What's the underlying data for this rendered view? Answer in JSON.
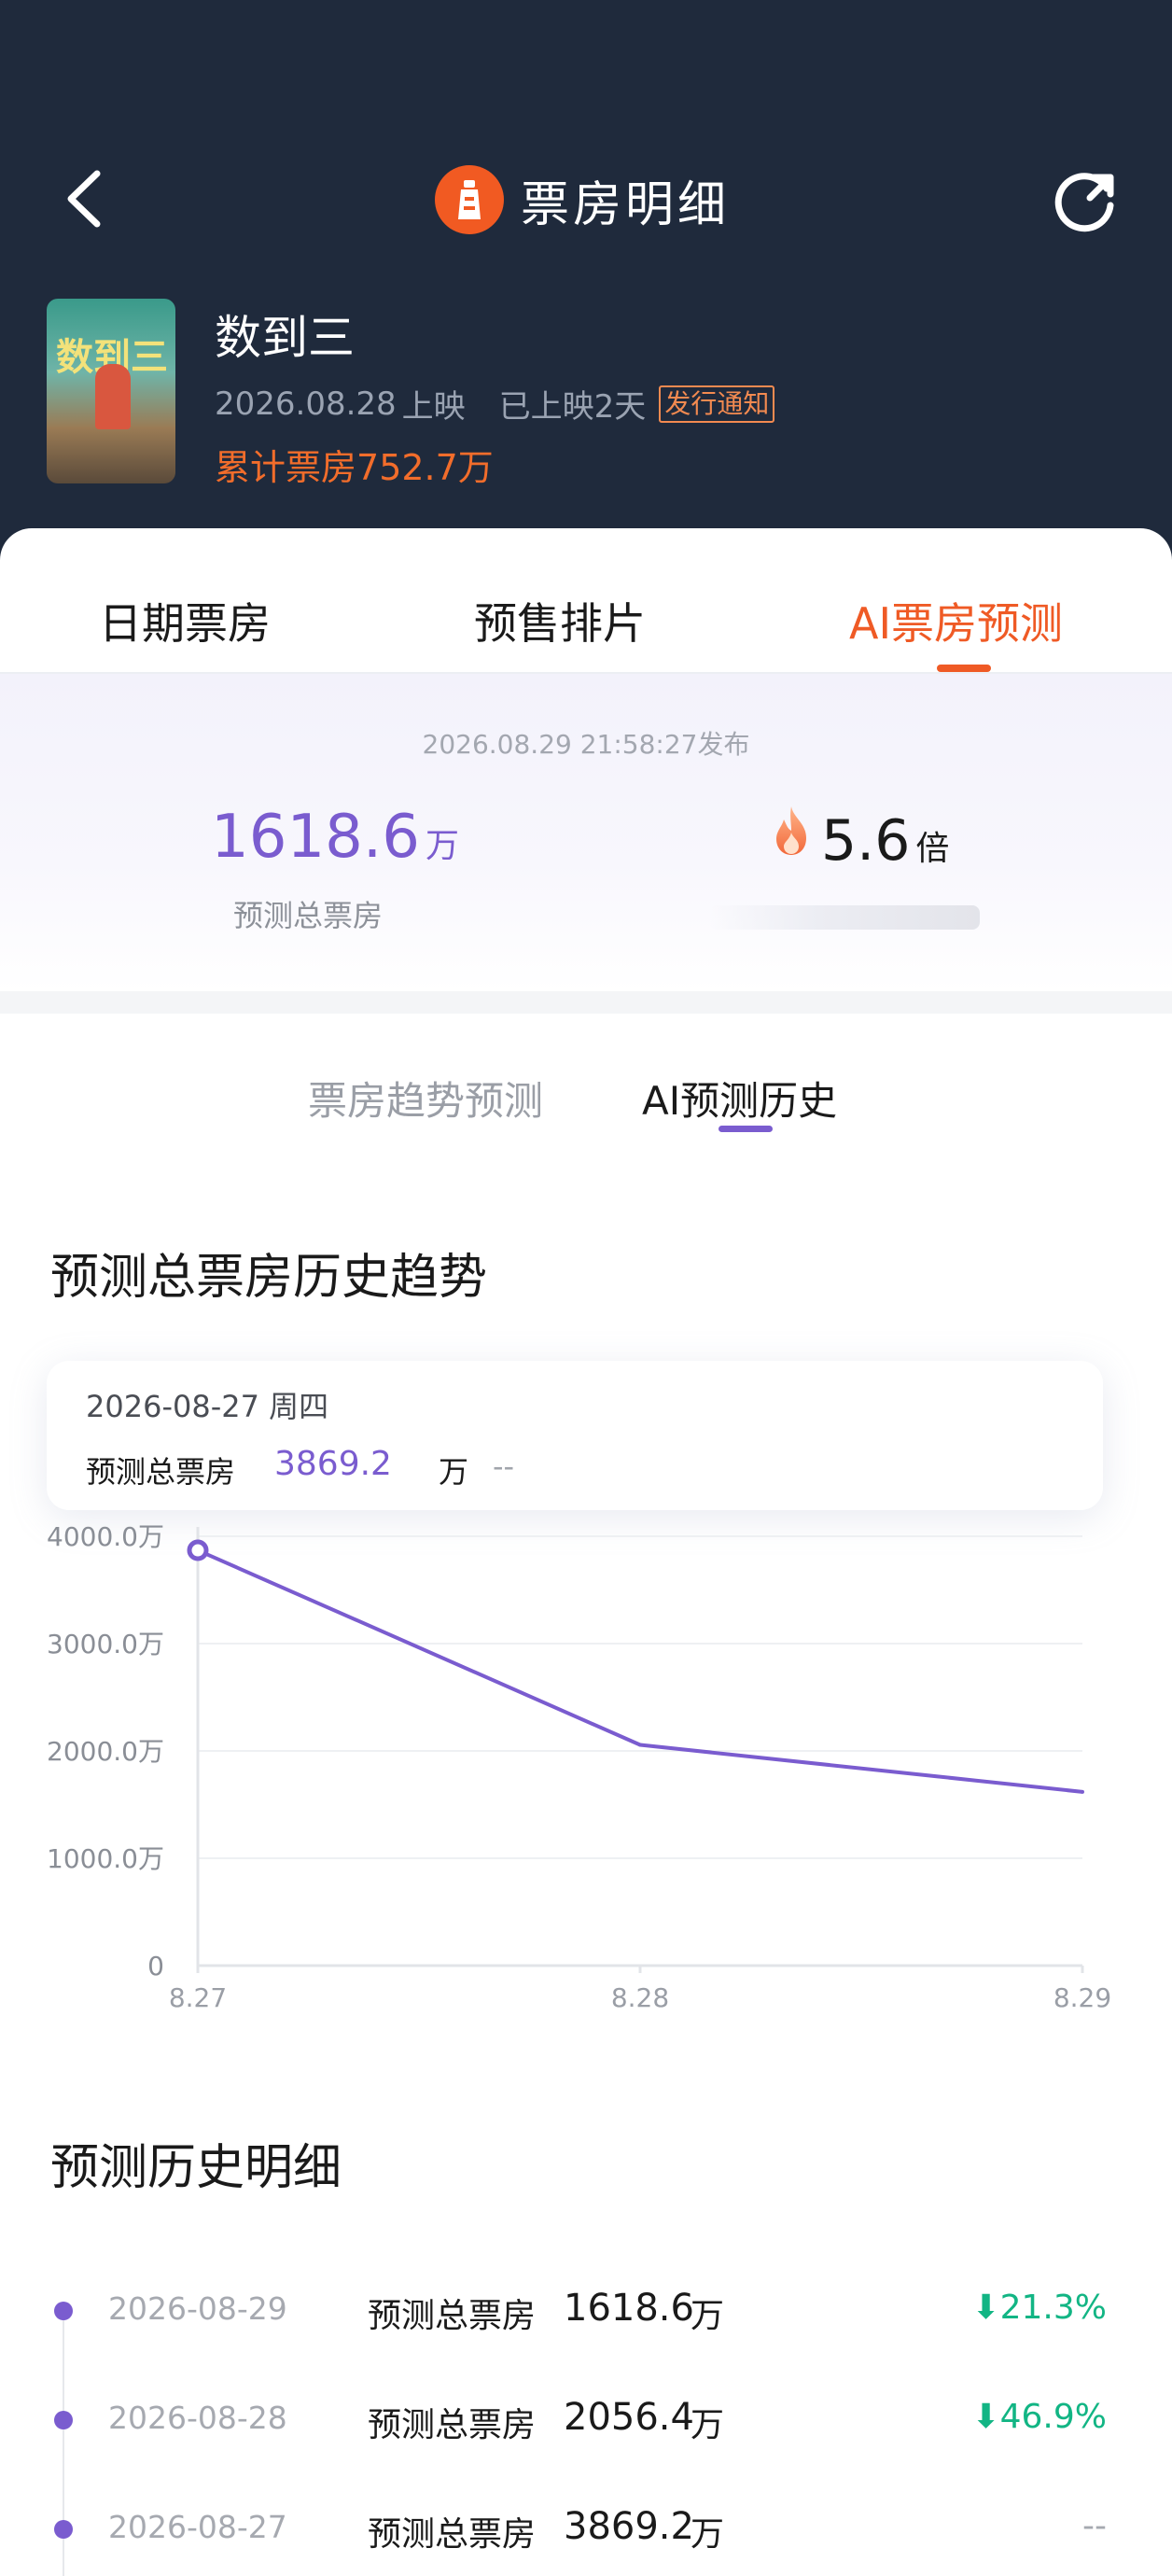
{
  "header": {
    "title": "票房明细",
    "movie_name": "数到三",
    "release_date": "2026.08.28",
    "release_suffix": "上映",
    "days_shown": "已上映2天",
    "notice": "发行通知",
    "total_label": "累计票房",
    "total_value": "752.7万",
    "poster_text": "数到三"
  },
  "tabs": [
    "日期票房",
    "预售排片",
    "AI票房预测"
  ],
  "active_tab": 2,
  "prediction": {
    "published": "2026.08.29 21:58:27发布",
    "total_value": "1618.6",
    "total_unit": "万",
    "total_label": "预测总票房",
    "multiple_value": "5.6",
    "multiple_unit": "倍"
  },
  "subtabs": [
    "票房趋势预测",
    "AI预测历史"
  ],
  "active_subtab": 1,
  "trend_section": {
    "title": "预测总票房历史趋势",
    "tooltip": {
      "date": "2026-08-27   周四",
      "label": "预测总票房",
      "value": "3869.2",
      "unit": "万",
      "change": "--"
    }
  },
  "chart_data": {
    "type": "line",
    "x": [
      "8.27",
      "8.28",
      "8.29"
    ],
    "series": [
      {
        "values": [
          3869.2,
          2056.4,
          1618.6
        ]
      }
    ],
    "ylim": [
      0,
      4000
    ],
    "yticks": [
      "0",
      "1000.0万",
      "2000.0万",
      "3000.0万",
      "4000.0万"
    ],
    "grid": true,
    "color": "#7a5ccf"
  },
  "history_section": {
    "title": "预测历史明细",
    "rows": [
      {
        "date": "2026-08-29",
        "label": "预测总票房",
        "value": "1618.6",
        "unit": "万",
        "change": "21.3%"
      },
      {
        "date": "2026-08-28",
        "label": "预测总票房",
        "value": "2056.4",
        "unit": "万",
        "change": "46.9%"
      },
      {
        "date": "2026-08-27",
        "label": "预测总票房",
        "value": "3869.2",
        "unit": "万",
        "change": "--"
      }
    ]
  },
  "colors": {
    "accent_orange": "#ef5a25",
    "accent_purple": "#7a5ccf",
    "down_green": "#12b584",
    "header_bg": "#1f2a3c"
  }
}
